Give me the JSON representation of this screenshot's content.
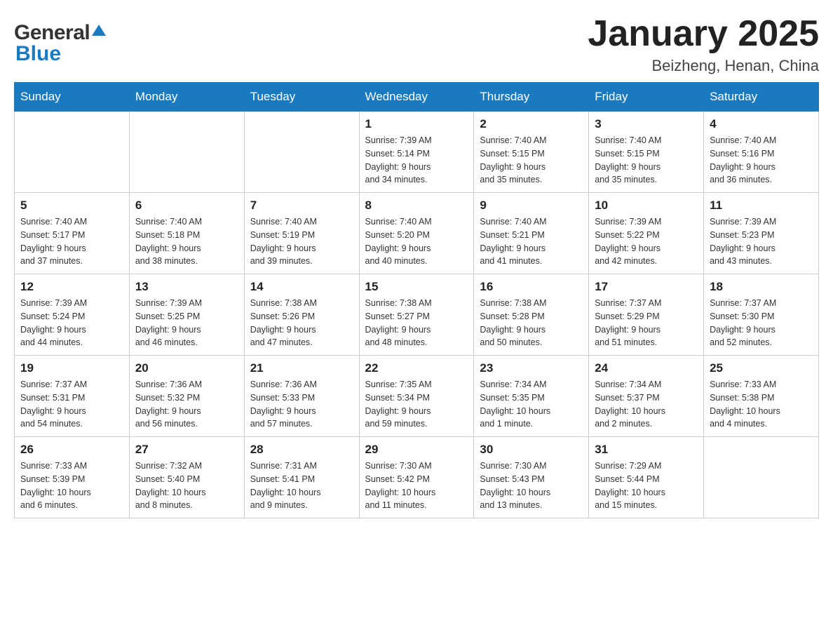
{
  "header": {
    "logo_general": "General",
    "logo_blue": "Blue",
    "month_title": "January 2025",
    "location": "Beizheng, Henan, China"
  },
  "weekdays": [
    "Sunday",
    "Monday",
    "Tuesday",
    "Wednesday",
    "Thursday",
    "Friday",
    "Saturday"
  ],
  "weeks": [
    [
      {
        "day": "",
        "info": ""
      },
      {
        "day": "",
        "info": ""
      },
      {
        "day": "",
        "info": ""
      },
      {
        "day": "1",
        "info": "Sunrise: 7:39 AM\nSunset: 5:14 PM\nDaylight: 9 hours\nand 34 minutes."
      },
      {
        "day": "2",
        "info": "Sunrise: 7:40 AM\nSunset: 5:15 PM\nDaylight: 9 hours\nand 35 minutes."
      },
      {
        "day": "3",
        "info": "Sunrise: 7:40 AM\nSunset: 5:15 PM\nDaylight: 9 hours\nand 35 minutes."
      },
      {
        "day": "4",
        "info": "Sunrise: 7:40 AM\nSunset: 5:16 PM\nDaylight: 9 hours\nand 36 minutes."
      }
    ],
    [
      {
        "day": "5",
        "info": "Sunrise: 7:40 AM\nSunset: 5:17 PM\nDaylight: 9 hours\nand 37 minutes."
      },
      {
        "day": "6",
        "info": "Sunrise: 7:40 AM\nSunset: 5:18 PM\nDaylight: 9 hours\nand 38 minutes."
      },
      {
        "day": "7",
        "info": "Sunrise: 7:40 AM\nSunset: 5:19 PM\nDaylight: 9 hours\nand 39 minutes."
      },
      {
        "day": "8",
        "info": "Sunrise: 7:40 AM\nSunset: 5:20 PM\nDaylight: 9 hours\nand 40 minutes."
      },
      {
        "day": "9",
        "info": "Sunrise: 7:40 AM\nSunset: 5:21 PM\nDaylight: 9 hours\nand 41 minutes."
      },
      {
        "day": "10",
        "info": "Sunrise: 7:39 AM\nSunset: 5:22 PM\nDaylight: 9 hours\nand 42 minutes."
      },
      {
        "day": "11",
        "info": "Sunrise: 7:39 AM\nSunset: 5:23 PM\nDaylight: 9 hours\nand 43 minutes."
      }
    ],
    [
      {
        "day": "12",
        "info": "Sunrise: 7:39 AM\nSunset: 5:24 PM\nDaylight: 9 hours\nand 44 minutes."
      },
      {
        "day": "13",
        "info": "Sunrise: 7:39 AM\nSunset: 5:25 PM\nDaylight: 9 hours\nand 46 minutes."
      },
      {
        "day": "14",
        "info": "Sunrise: 7:38 AM\nSunset: 5:26 PM\nDaylight: 9 hours\nand 47 minutes."
      },
      {
        "day": "15",
        "info": "Sunrise: 7:38 AM\nSunset: 5:27 PM\nDaylight: 9 hours\nand 48 minutes."
      },
      {
        "day": "16",
        "info": "Sunrise: 7:38 AM\nSunset: 5:28 PM\nDaylight: 9 hours\nand 50 minutes."
      },
      {
        "day": "17",
        "info": "Sunrise: 7:37 AM\nSunset: 5:29 PM\nDaylight: 9 hours\nand 51 minutes."
      },
      {
        "day": "18",
        "info": "Sunrise: 7:37 AM\nSunset: 5:30 PM\nDaylight: 9 hours\nand 52 minutes."
      }
    ],
    [
      {
        "day": "19",
        "info": "Sunrise: 7:37 AM\nSunset: 5:31 PM\nDaylight: 9 hours\nand 54 minutes."
      },
      {
        "day": "20",
        "info": "Sunrise: 7:36 AM\nSunset: 5:32 PM\nDaylight: 9 hours\nand 56 minutes."
      },
      {
        "day": "21",
        "info": "Sunrise: 7:36 AM\nSunset: 5:33 PM\nDaylight: 9 hours\nand 57 minutes."
      },
      {
        "day": "22",
        "info": "Sunrise: 7:35 AM\nSunset: 5:34 PM\nDaylight: 9 hours\nand 59 minutes."
      },
      {
        "day": "23",
        "info": "Sunrise: 7:34 AM\nSunset: 5:35 PM\nDaylight: 10 hours\nand 1 minute."
      },
      {
        "day": "24",
        "info": "Sunrise: 7:34 AM\nSunset: 5:37 PM\nDaylight: 10 hours\nand 2 minutes."
      },
      {
        "day": "25",
        "info": "Sunrise: 7:33 AM\nSunset: 5:38 PM\nDaylight: 10 hours\nand 4 minutes."
      }
    ],
    [
      {
        "day": "26",
        "info": "Sunrise: 7:33 AM\nSunset: 5:39 PM\nDaylight: 10 hours\nand 6 minutes."
      },
      {
        "day": "27",
        "info": "Sunrise: 7:32 AM\nSunset: 5:40 PM\nDaylight: 10 hours\nand 8 minutes."
      },
      {
        "day": "28",
        "info": "Sunrise: 7:31 AM\nSunset: 5:41 PM\nDaylight: 10 hours\nand 9 minutes."
      },
      {
        "day": "29",
        "info": "Sunrise: 7:30 AM\nSunset: 5:42 PM\nDaylight: 10 hours\nand 11 minutes."
      },
      {
        "day": "30",
        "info": "Sunrise: 7:30 AM\nSunset: 5:43 PM\nDaylight: 10 hours\nand 13 minutes."
      },
      {
        "day": "31",
        "info": "Sunrise: 7:29 AM\nSunset: 5:44 PM\nDaylight: 10 hours\nand 15 minutes."
      },
      {
        "day": "",
        "info": ""
      }
    ]
  ]
}
